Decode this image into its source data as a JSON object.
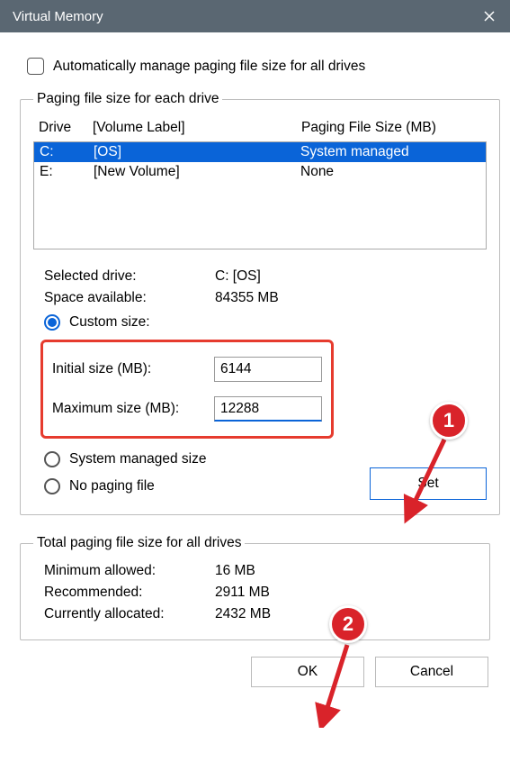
{
  "title": "Virtual Memory",
  "auto_manage_label": "Automatically manage paging file size for all drives",
  "group_drive_legend": "Paging file size for each drive",
  "head_drive": "Drive",
  "head_volume": "[Volume Label]",
  "head_pf": "Paging File Size (MB)",
  "drives": [
    {
      "letter": "C:",
      "label": "[OS]",
      "pf": "System managed"
    },
    {
      "letter": "E:",
      "label": "[New Volume]",
      "pf": "None"
    }
  ],
  "selected_drive_label": "Selected drive:",
  "selected_drive_value": "C:  [OS]",
  "space_label": "Space available:",
  "space_value": "84355 MB",
  "custom_size_label": "Custom size:",
  "initial_label": "Initial size (MB):",
  "initial_value": "6144",
  "maximum_label": "Maximum size (MB):",
  "maximum_value": "12288",
  "system_managed_label": "System managed size",
  "no_paging_label": "No paging file",
  "set_btn": "Set",
  "group_total_legend": "Total paging file size for all drives",
  "min_allowed_label": "Minimum allowed:",
  "min_allowed_value": "16 MB",
  "recommended_label": "Recommended:",
  "recommended_value": "2911 MB",
  "currently_label": "Currently allocated:",
  "currently_value": "2432 MB",
  "ok_btn": "OK",
  "cancel_btn": "Cancel",
  "annotation_1": "1",
  "annotation_2": "2"
}
